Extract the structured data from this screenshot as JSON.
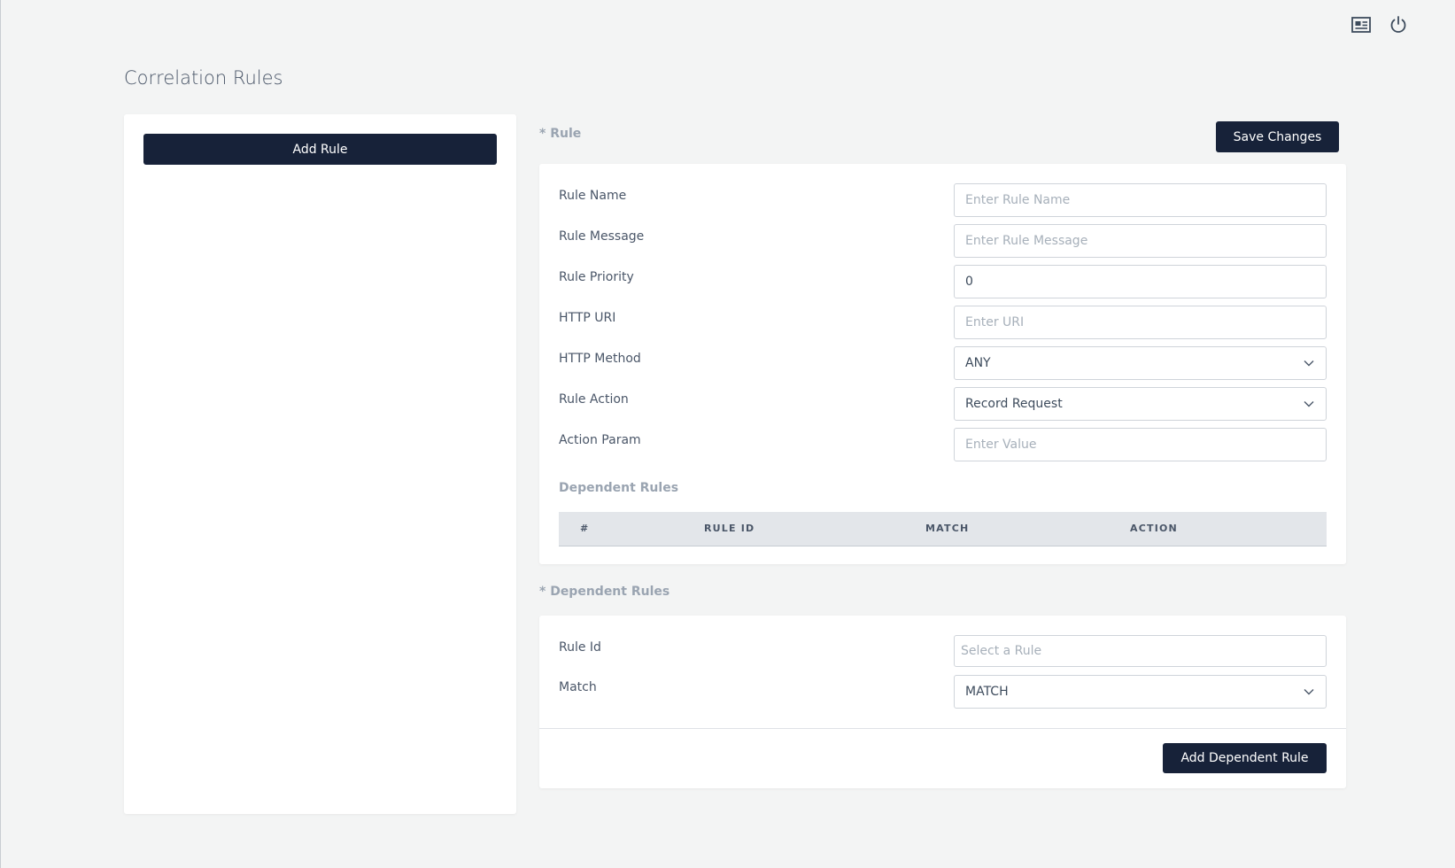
{
  "page": {
    "title": "Correlation Rules"
  },
  "header": {
    "icons": [
      "news-icon",
      "power-icon"
    ]
  },
  "rules_panel": {
    "add_rule_label": "Add Rule"
  },
  "rule_section": {
    "label": "* Rule",
    "save_label": "Save Changes",
    "fields": [
      {
        "label": "Rule Name",
        "value": "",
        "placeholder": "Enter Rule Name"
      },
      {
        "label": "Rule Message",
        "value": "",
        "placeholder": "Enter Rule Message"
      },
      {
        "label": "Rule Priority",
        "value": "0",
        "placeholder": ""
      },
      {
        "label": "HTTP URI",
        "value": "",
        "placeholder": "Enter URI"
      },
      {
        "label": "HTTP Method",
        "value": "ANY",
        "placeholder": ""
      },
      {
        "label": "Rule Action",
        "value": "Record Request",
        "placeholder": ""
      },
      {
        "label": "Action Param",
        "value": "",
        "placeholder": "Enter Value"
      }
    ],
    "dependent_rules_title": "Dependent Rules",
    "table_headers": [
      "#",
      "RULE ID",
      "MATCH",
      "ACTION"
    ]
  },
  "dependent_section": {
    "label": "* Dependent Rules",
    "fields": [
      {
        "label": "Rule Id",
        "value": "",
        "placeholder": "Select a Rule"
      },
      {
        "label": "Match",
        "value": "MATCH",
        "placeholder": ""
      }
    ],
    "add_label": "Add Dependent Rule"
  },
  "colors": {
    "primary_button": "#172239",
    "background": "#f3f4f4",
    "card": "#ffffff",
    "muted_label": "#9aa4b1"
  }
}
